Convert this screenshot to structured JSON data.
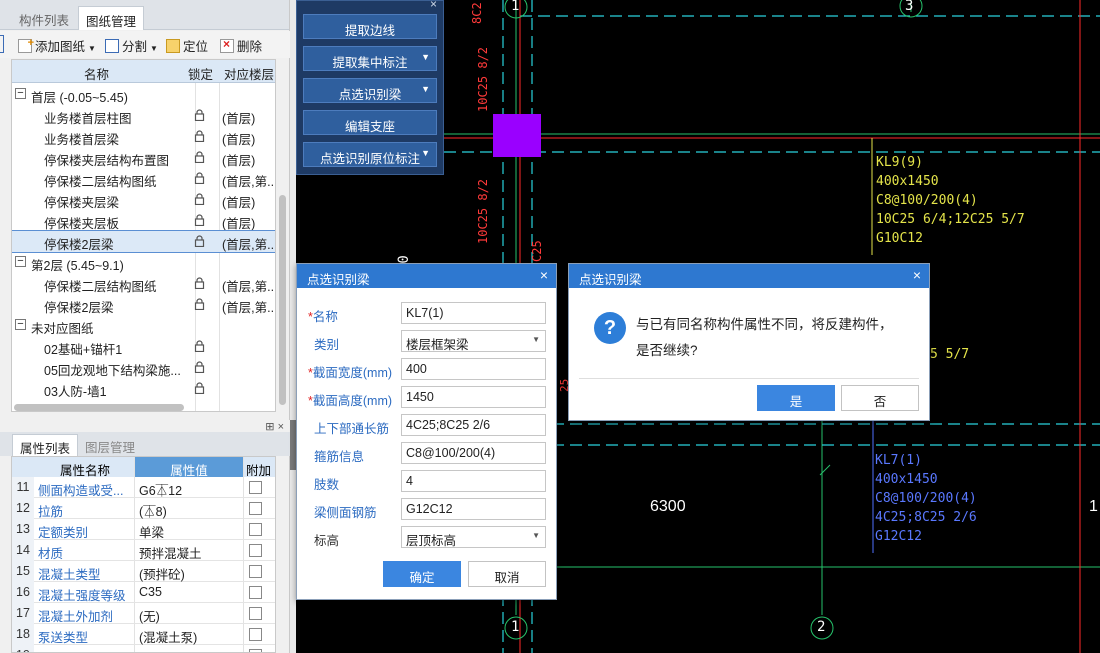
{
  "left_panel": {
    "tabs": [
      "构件列表",
      "图纸管理"
    ],
    "toolbar": {
      "add": "添加图纸",
      "split": "分割",
      "locate": "定位",
      "delete": "删除"
    },
    "tree_headers": {
      "name": "名称",
      "lock": "锁定",
      "floor": "对应楼层"
    },
    "tree_rows": [
      {
        "name": "首层 (-0.05~5.45)",
        "group": true,
        "floor": ""
      },
      {
        "name": "业务楼首层柱图",
        "group": false,
        "floor": "(首层)"
      },
      {
        "name": "业务楼首层梁",
        "group": false,
        "floor": "(首层)"
      },
      {
        "name": "停保楼夹层结构布置图",
        "group": false,
        "floor": "(首层)"
      },
      {
        "name": "停保楼二层结构图纸",
        "group": false,
        "floor": "(首层,第..."
      },
      {
        "name": "停保楼夹层梁",
        "group": false,
        "floor": "(首层)"
      },
      {
        "name": "停保楼夹层板",
        "group": false,
        "floor": "(首层)"
      },
      {
        "name": "停保楼2层梁",
        "group": false,
        "floor": "(首层,第..."
      },
      {
        "name": "第2层 (5.45~9.1)",
        "group": true,
        "floor": ""
      },
      {
        "name": "停保楼二层结构图纸",
        "group": false,
        "floor": "(首层,第..."
      },
      {
        "name": "停保楼2层梁",
        "group": false,
        "floor": "(首层,第..."
      },
      {
        "name": "未对应图纸",
        "group": true,
        "floor": ""
      },
      {
        "name": "02基础+锚杆1",
        "group": false,
        "floor": ""
      },
      {
        "name": "05回龙观地下结构梁施...",
        "group": false,
        "floor": ""
      },
      {
        "name": "03人防-墙1",
        "group": false,
        "floor": ""
      }
    ]
  },
  "props_panel": {
    "tabs": [
      "属性列表",
      "图层管理"
    ],
    "headers": {
      "name": "属性名称",
      "value": "属性值",
      "extra": "附加"
    },
    "rows": [
      {
        "idx": "11",
        "name": "侧面构造或受...",
        "value": "G6⏄12"
      },
      {
        "idx": "12",
        "name": "拉筋",
        "value": "(⏄8)"
      },
      {
        "idx": "13",
        "name": "定额类别",
        "value": "单梁"
      },
      {
        "idx": "14",
        "name": "材质",
        "value": "预拌混凝土"
      },
      {
        "idx": "15",
        "name": "混凝土类型",
        "value": "(预拌砼)"
      },
      {
        "idx": "16",
        "name": "混凝土强度等级",
        "value": "C35"
      },
      {
        "idx": "17",
        "name": "混凝土外加剂",
        "value": "(无)"
      },
      {
        "idx": "18",
        "name": "泵送类型",
        "value": "(混凝土泵)"
      },
      {
        "idx": "19",
        "name": "泵送高度(m)",
        "value": ""
      }
    ]
  },
  "tool_panel": {
    "buttons": [
      {
        "label": "提取边线",
        "dropdown": false
      },
      {
        "label": "提取集中标注",
        "dropdown": true
      },
      {
        "label": "点选识别梁",
        "dropdown": true
      },
      {
        "label": "编辑支座",
        "dropdown": false
      },
      {
        "label": "点选识别原位标注",
        "dropdown": true
      }
    ]
  },
  "beam_dialog": {
    "title": "点选识别梁",
    "fields": [
      {
        "label": "名称",
        "required": true,
        "value": "KL7(1)",
        "dropdown": false,
        "plain": false
      },
      {
        "label": "类别",
        "required": false,
        "value": "楼层框架梁",
        "dropdown": true,
        "plain": false
      },
      {
        "label": "截面宽度(mm)",
        "required": true,
        "value": "400",
        "dropdown": false,
        "plain": false
      },
      {
        "label": "截面高度(mm)",
        "required": true,
        "value": "1450",
        "dropdown": false,
        "plain": false
      },
      {
        "label": "上下部通长筋",
        "required": false,
        "value": "4C25;8C25 2/6",
        "dropdown": false,
        "plain": false
      },
      {
        "label": "箍筋信息",
        "required": false,
        "value": "C8@100/200(4)",
        "dropdown": false,
        "plain": false
      },
      {
        "label": "肢数",
        "required": false,
        "value": "4",
        "dropdown": false,
        "plain": false
      },
      {
        "label": "梁侧面钢筋",
        "required": false,
        "value": "G12C12",
        "dropdown": false,
        "plain": false
      },
      {
        "label": "标高",
        "required": false,
        "value": "层顶标高",
        "dropdown": true,
        "plain": true
      }
    ],
    "ok": "确定",
    "cancel": "取消"
  },
  "confirm_dialog": {
    "title": "点选识别梁",
    "message_line1": "与已有同名称构件属性不同，将反建构件，",
    "message_line2": "是否继续?",
    "yes": "是",
    "no": "否"
  },
  "canvas": {
    "axis_labels": [
      "3",
      "1",
      "2",
      "1"
    ],
    "dimension": "6300",
    "edge_digit": "1",
    "note_upper": [
      "KL9(9)",
      "400x1450",
      "C8@100/200(4)",
      "10C25 6/4;12C25 5/7",
      "G10C12"
    ],
    "note_lower": [
      "KL7(1)",
      "400x1450",
      "C8@100/200(4)",
      "4C25;8C25 2/6",
      "G12C12"
    ],
    "partial_57": "5 5/7",
    "partial_25": "25",
    "vtext": [
      "8C2",
      "10C25 8/2",
      "10C25 8/2",
      "C25",
      "00"
    ],
    "colors": {
      "grid_line": "#26c26b",
      "cyan": "#29d1dc",
      "red": "#ff2a2a",
      "yellow": "#e4e44a",
      "blue": "#4f6fff",
      "magenta": "#9a00ff"
    }
  }
}
